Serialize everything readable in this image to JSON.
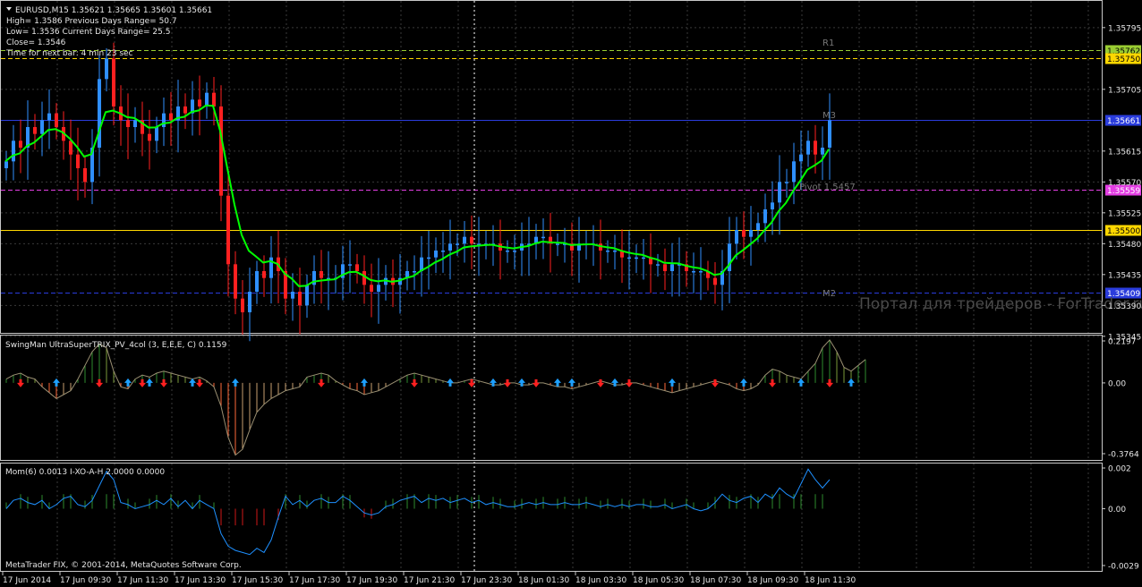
{
  "main": {
    "header": "EURUSD,M15  1.35621 1.35665 1.35601 1.35661",
    "info": [
      "High= 1.3586    Previous Days Range= 50.7",
      "Low= 1.3536    Current Days Range= 25.5",
      "Close= 1.3546",
      "Time for next bar: 4 min 23 sec"
    ],
    "ylim": [
      1.3535,
      1.3583
    ],
    "y_ticks": [
      "1.35795",
      "1.35705",
      "1.35615",
      "1.35570",
      "1.35525",
      "1.35480",
      "1.35435",
      "1.35390",
      "1.35345"
    ],
    "labels": {
      "r1": "R1",
      "m3": "M3",
      "pivot": "Pivot  1.5457",
      "m2": "M2"
    },
    "levels": [
      {
        "name": "r1-upper",
        "price": 1.35762,
        "label": "1.35762",
        "color": "#9acd32",
        "text_color": "#000000",
        "style": "dash"
      },
      {
        "name": "r1-lower",
        "price": 1.3575,
        "label": "1.35750",
        "color": "#ffd700",
        "text_color": "#000000",
        "style": "dash"
      },
      {
        "name": "blue-upper",
        "price": 1.35661,
        "label": "1.35661",
        "color": "#2a3cdc",
        "text_color": "#ffffff",
        "style": "solid"
      },
      {
        "name": "magenta",
        "price": 1.35559,
        "label": "1.35559",
        "color": "#e23ee2",
        "text_color": "#ffffff",
        "style": "dash"
      },
      {
        "name": "gold",
        "price": 1.355,
        "label": "1.35500",
        "color": "#ffd700",
        "text_color": "#000000",
        "style": "solid"
      },
      {
        "name": "blue-lower",
        "price": 1.35409,
        "label": "1.35409",
        "color": "#2a3cdc",
        "text_color": "#ffffff",
        "style": "dash"
      }
    ],
    "watermark": "Портал для трейдеров - ForTrader.ru"
  },
  "trix": {
    "header": "SwingMan UltraSuperTRIX_PV_4col (3, E,E,E, C) 0.1159",
    "ylim": [
      -0.3764,
      0.2197
    ],
    "y_ticks": [
      "0.2197",
      "0.00",
      "-0.3764"
    ]
  },
  "mom": {
    "header": "Mom(6) 0.0013  I-XO-A-H 2.0000 0.0000",
    "ylim": [
      -0.0029,
      0.002
    ],
    "y_ticks": [
      "0.002",
      "0.00",
      "-0.0029"
    ],
    "copyright": "MetaTrader FIX, © 2001-2014, MetaQuotes Software Corp."
  },
  "x_axis": {
    "labels": [
      "17 Jun 2014",
      "17 Jun 09:30",
      "17 Jun 11:30",
      "17 Jun 13:30",
      "17 Jun 15:30",
      "17 Jun 17:30",
      "17 Jun 19:30",
      "17 Jun 21:30",
      "17 Jun 23:30",
      "18 Jun 01:30",
      "18 Jun 03:30",
      "18 Jun 05:30",
      "18 Jun 07:30",
      "18 Jun 09:30",
      "18 Jun 11:30"
    ]
  },
  "chart_data": [
    {
      "type": "candlestick",
      "title": "EURUSD,M15",
      "bar_count": 116,
      "close": [
        1.356,
        1.3563,
        1.3562,
        1.3565,
        1.3564,
        1.3566,
        1.3567,
        1.3565,
        1.3563,
        1.3561,
        1.3559,
        1.3557,
        1.3562,
        1.3572,
        1.3575,
        1.3568,
        1.3566,
        1.3565,
        1.3566,
        1.3564,
        1.3563,
        1.3565,
        1.3567,
        1.3566,
        1.3568,
        1.3567,
        1.3569,
        1.3568,
        1.357,
        1.3568,
        1.3555,
        1.3545,
        1.354,
        1.3538,
        1.3541,
        1.3544,
        1.3543,
        1.3546,
        1.3544,
        1.354,
        1.3541,
        1.3539,
        1.3542,
        1.3544,
        1.3543,
        1.3543,
        1.3543,
        1.3545,
        1.3545,
        1.3544,
        1.3542,
        1.3541,
        1.3542,
        1.3543,
        1.3542,
        1.3543,
        1.3544,
        1.3544,
        1.3546,
        1.3546,
        1.3547,
        1.3547,
        1.3548,
        1.3548,
        1.3549,
        1.3548,
        1.3548,
        1.3548,
        1.3548,
        1.3547,
        1.3547,
        1.3547,
        1.3548,
        1.3548,
        1.3549,
        1.3549,
        1.3548,
        1.3548,
        1.3548,
        1.3547,
        1.3548,
        1.3548,
        1.3548,
        1.3547,
        1.3547,
        1.3547,
        1.3546,
        1.3546,
        1.3546,
        1.3546,
        1.3545,
        1.3545,
        1.3544,
        1.3545,
        1.3545,
        1.3544,
        1.3544,
        1.3544,
        1.3543,
        1.3542,
        1.3544,
        1.3548,
        1.355,
        1.3549,
        1.355,
        1.3551,
        1.3553,
        1.3554,
        1.3557,
        1.3557,
        1.356,
        1.3561,
        1.3563,
        1.3561,
        1.3562,
        1.3566
      ]
    },
    {
      "type": "line",
      "title": "SwingMan UltraSuperTRIX_PV_4col (3, E,E,E, C) 0.1159",
      "ylim": [
        -0.3764,
        0.2197
      ],
      "values": [
        0.02,
        0.04,
        0.05,
        0.03,
        0.02,
        -0.02,
        -0.05,
        -0.08,
        -0.06,
        -0.04,
        0.02,
        0.09,
        0.16,
        0.2,
        0.18,
        0.06,
        -0.02,
        -0.03,
        0.02,
        0.04,
        0.03,
        0.05,
        0.06,
        0.05,
        0.04,
        0.03,
        0.02,
        0.03,
        0.01,
        -0.02,
        -0.12,
        -0.28,
        -0.37,
        -0.34,
        -0.24,
        -0.15,
        -0.11,
        -0.08,
        -0.06,
        -0.04,
        -0.03,
        -0.02,
        0.03,
        0.04,
        0.05,
        0.04,
        0.01,
        -0.01,
        -0.03,
        -0.04,
        -0.06,
        -0.05,
        -0.04,
        -0.02,
        0.0,
        0.02,
        0.04,
        0.05,
        0.04,
        0.03,
        0.02,
        0.01,
        0.0,
        0.0,
        0.01,
        0.02,
        0.01,
        0.0,
        -0.01,
        -0.01,
        0.0,
        0.0,
        -0.01,
        -0.01,
        0.0,
        0.0,
        -0.01,
        -0.02,
        -0.02,
        -0.03,
        -0.02,
        -0.01,
        0.0,
        0.01,
        0.0,
        -0.01,
        -0.01,
        0.0,
        0.0,
        -0.01,
        -0.02,
        -0.03,
        -0.04,
        -0.05,
        -0.04,
        -0.03,
        -0.02,
        -0.01,
        0.0,
        0.01,
        0.0,
        -0.01,
        -0.03,
        -0.04,
        -0.03,
        -0.01,
        0.04,
        0.07,
        0.06,
        0.04,
        0.03,
        0.02,
        0.06,
        0.1,
        0.18,
        0.22,
        0.16,
        0.08,
        0.06,
        0.09,
        0.12
      ]
    },
    {
      "type": "line",
      "title": "Mom(6) 0.0013",
      "ylim": [
        -0.0029,
        0.002
      ],
      "values": [
        0.0,
        0.0004,
        0.0005,
        0.0003,
        0.0002,
        0.0004,
        0.0,
        0.0002,
        0.0005,
        0.0006,
        0.0002,
        0.0001,
        0.0004,
        0.0011,
        0.0018,
        0.0014,
        0.0003,
        0.0002,
        0.0,
        0.0001,
        0.0002,
        0.0004,
        0.0002,
        0.0005,
        0.0001,
        0.0004,
        0.0,
        0.0004,
        0.0002,
        0.0,
        -0.0012,
        -0.0018,
        -0.002,
        -0.0021,
        -0.0022,
        -0.0019,
        -0.0021,
        -0.0015,
        -0.0004,
        0.0006,
        0.0002,
        0.0004,
        0.0001,
        0.0004,
        0.0005,
        0.0003,
        0.0003,
        0.0006,
        0.0004,
        0.0001,
        -0.0002,
        -0.0003,
        -0.0002,
        0.0001,
        0.0002,
        0.0004,
        0.0005,
        0.0006,
        0.0003,
        0.0005,
        0.0004,
        0.0005,
        0.0003,
        0.0004,
        0.0005,
        0.0003,
        0.0004,
        0.0002,
        0.0003,
        0.0002,
        0.0001,
        0.0001,
        0.0002,
        0.0003,
        0.0002,
        0.0003,
        0.0002,
        0.0002,
        0.0003,
        0.0002,
        0.0002,
        0.0003,
        0.0002,
        0.0001,
        0.0002,
        0.0001,
        0.0002,
        0.0001,
        0.0002,
        0.0002,
        0.0001,
        0.0001,
        0.0002,
        0.0,
        0.0001,
        0.0002,
        0.0,
        -0.0001,
        0.0,
        0.0003,
        0.0007,
        0.0004,
        0.0003,
        0.0005,
        0.0006,
        0.0003,
        0.0007,
        0.0005,
        0.001,
        0.0007,
        0.0005,
        0.0012,
        0.0019,
        0.0014,
        0.001,
        0.0014
      ]
    }
  ]
}
